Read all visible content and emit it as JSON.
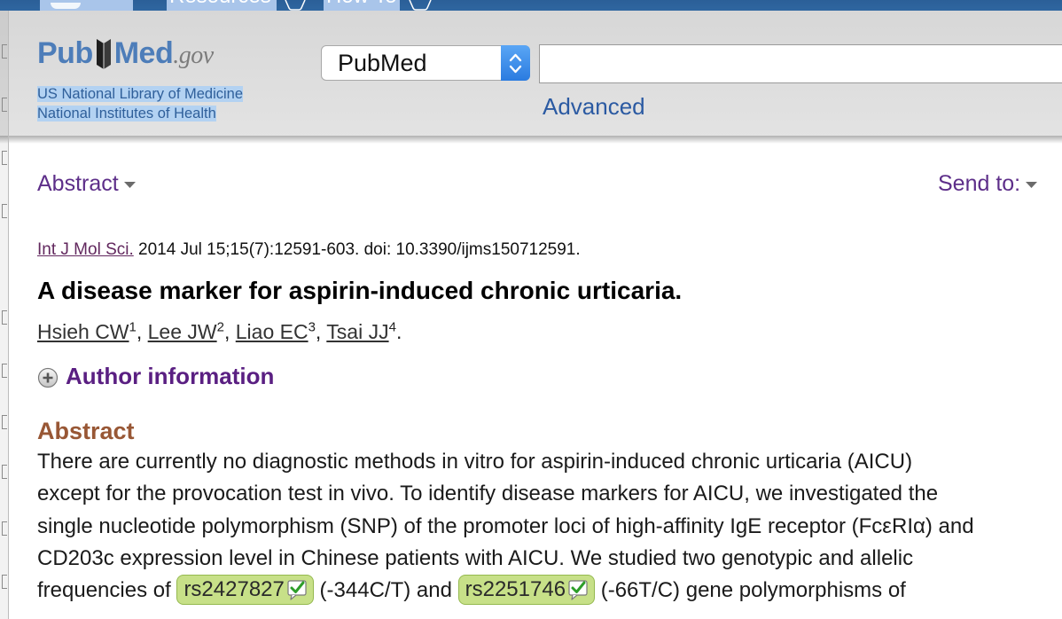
{
  "topbar": {
    "resources": "Resources",
    "how_to": "How To"
  },
  "header": {
    "logo": {
      "pub": "Pub",
      "med": "Med",
      "gov": ".gov"
    },
    "org_line1": "US National Library of Medicine",
    "org_line2": "National Institutes of Health",
    "database_select": {
      "value": "PubMed"
    },
    "search_input": {
      "value": ""
    },
    "advanced_link": "Advanced"
  },
  "toolbar": {
    "format_label": "Abstract",
    "send_to_label": "Send to:"
  },
  "citation": {
    "journal": "Int J Mol Sci.",
    "details": " 2014 Jul 15;15(7):12591-603. doi: 10.3390/ijms150712591."
  },
  "article": {
    "title": "A disease marker for aspirin-induced chronic urticaria.",
    "authors": [
      {
        "name": "Hsieh CW",
        "sup": "1",
        "after": ", "
      },
      {
        "name": "Lee JW",
        "sup": "2",
        "after": ", "
      },
      {
        "name": "Liao EC",
        "sup": "3",
        "after": ", "
      },
      {
        "name": "Tsai JJ",
        "sup": "4",
        "after": "."
      }
    ],
    "author_info": {
      "label": "Author information",
      "icon": "plus-circle-icon"
    }
  },
  "abstract": {
    "heading": "Abstract",
    "lines": [
      "There are currently no diagnostic methods in vitro for aspirin-induced chronic urticaria (AICU)",
      "except for the provocation test in vivo. To identify disease markers for AICU, we investigated the",
      "single nucleotide polymorphism (SNP) of the promoter loci of high-affinity IgE receptor (FcεRIα) and",
      "CD203c expression level in Chinese patients with AICU. We studied two genotypic and allelic"
    ],
    "snp_line": {
      "before": "frequencies of ",
      "snp1": "rs2427827",
      "mid": " (-344C/T) and ",
      "snp2": "rs2251746",
      "after": " (-66T/C) gene polymorphisms of"
    }
  },
  "colors": {
    "ncbi_blue": "#2f66a0",
    "link_purple": "#5d2e89",
    "heading_brown": "#985735",
    "snp_chip": "#c7e088",
    "advanced_blue": "#2b5aa2"
  }
}
